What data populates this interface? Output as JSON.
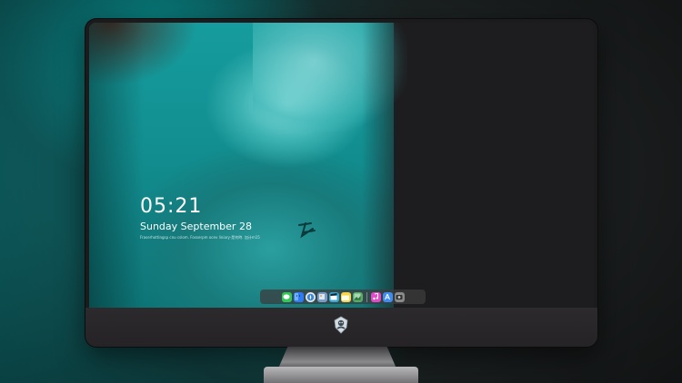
{
  "lockscreen": {
    "time": "05:21",
    "date": "Sunday September  28",
    "quote": "Fraserhottingsp cnu cslom. Fosserpm ocev liniary-是何時. 加计m15"
  },
  "dock": {
    "items": [
      {
        "name": "messages-icon",
        "color": "#34c759"
      },
      {
        "name": "finder-icon",
        "color": "#2f7bf6"
      },
      {
        "name": "safari-icon",
        "color": "#e8e8e8"
      },
      {
        "name": "preview-icon",
        "color": "#7a9cc6"
      },
      {
        "name": "claquette-icon",
        "color": "#3aa7d6"
      },
      {
        "name": "notes-icon",
        "color": "#f7d54a"
      },
      {
        "name": "photo-viewer-icon",
        "color": "#5aaa6a"
      },
      {
        "name": "itunes-icon",
        "color": "#e04cc5"
      },
      {
        "name": "app-store-icon",
        "color": "#3f8cf0"
      },
      {
        "name": "screenshot-icon",
        "color": "#8a8a8a"
      }
    ]
  },
  "colors": {
    "accent": "#169c9e",
    "monitor_frame": "#1b1b1d",
    "chin": "#2c2a2d"
  }
}
